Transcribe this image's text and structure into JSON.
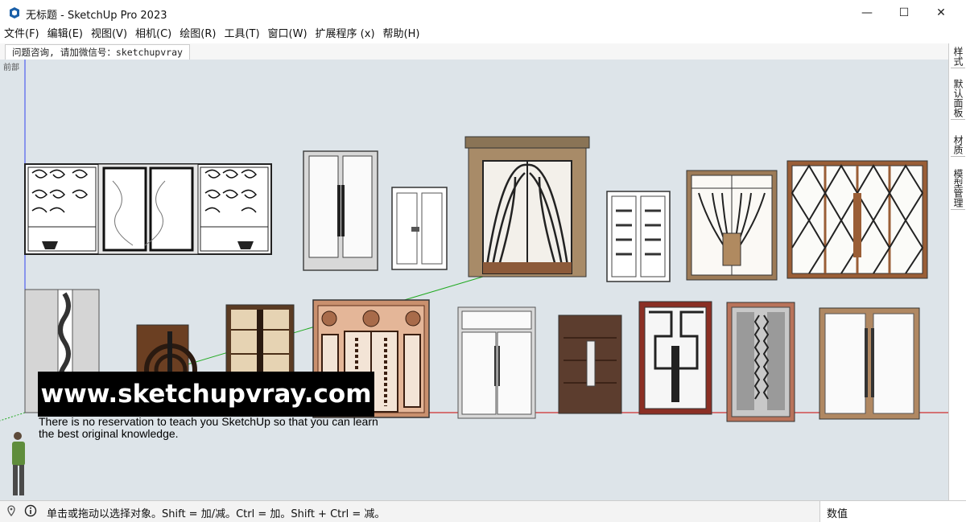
{
  "window": {
    "title": "无标题 - SketchUp Pro 2023",
    "minimize_glyph": "—",
    "maximize_glyph": "☐",
    "close_glyph": "✕"
  },
  "menu": [
    {
      "label": "文件(F)"
    },
    {
      "label": "编辑(E)"
    },
    {
      "label": "视图(V)"
    },
    {
      "label": "相机(C)"
    },
    {
      "label": "绘图(R)"
    },
    {
      "label": "工具(T)"
    },
    {
      "label": "窗口(W)"
    },
    {
      "label": "扩展程序 (x)"
    },
    {
      "label": "帮助(H)"
    }
  ],
  "scene_tab": {
    "label": "问题咨询, 请加微信号：sketchupvray"
  },
  "viewport": {
    "view_label": "前部",
    "background_color": "#dde4e9",
    "axis_colors": {
      "red": "#cc0000",
      "green": "#22aa22",
      "blue": "#3344ee"
    },
    "door_models": [
      {
        "name": "wrought-iron-triple-door",
        "style": "iron"
      },
      {
        "name": "white-glass-double-door",
        "style": "glass"
      },
      {
        "name": "white-panel-double-door",
        "style": "panel"
      },
      {
        "name": "marble-frame-arched-door",
        "style": "arched"
      },
      {
        "name": "white-grid-double-door",
        "style": "grid"
      },
      {
        "name": "fan-pattern-door",
        "style": "fan"
      },
      {
        "name": "diamond-lattice-sliding-door",
        "style": "diamond"
      },
      {
        "name": "wave-pivot-door",
        "style": "wave"
      },
      {
        "name": "circle-pattern-wood-door",
        "style": "circle"
      },
      {
        "name": "wood-stripe-double-door",
        "style": "stripe"
      },
      {
        "name": "copper-ornate-door",
        "style": "ornate"
      },
      {
        "name": "glass-transom-door",
        "style": "transom"
      },
      {
        "name": "walnut-double-door",
        "style": "walnut"
      },
      {
        "name": "meander-pattern-door",
        "style": "meander"
      },
      {
        "name": "glass-leaf-pattern-door",
        "style": "leaf"
      },
      {
        "name": "wood-frame-glass-door",
        "style": "woodglass"
      }
    ]
  },
  "watermark": {
    "url": "www.sketchupvray.com",
    "caption": "There is no reservation to teach you SketchUp so that you can learn\n the best original knowledge."
  },
  "right_tray": {
    "tabs": [
      {
        "label": "样式"
      },
      {
        "label": "默认面板"
      },
      {
        "label": "材质"
      },
      {
        "label": "模型管理"
      }
    ]
  },
  "status": {
    "hint": "单击或拖动以选择对象。Shift = 加/减。Ctrl = 加。Shift + Ctrl = 减。",
    "measurements_label": "数值",
    "measurements_value": ""
  }
}
